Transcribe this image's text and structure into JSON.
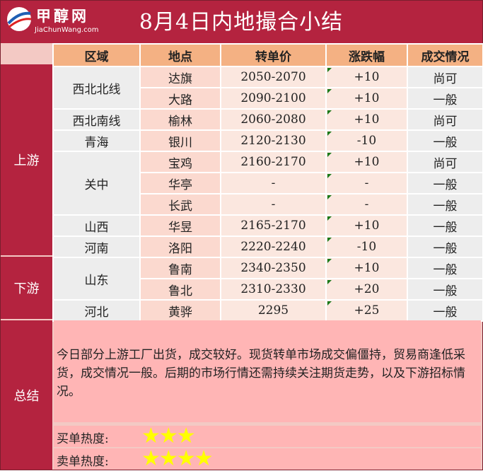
{
  "logo": {
    "cn": "甲醇网",
    "en": "JiaChunWang.com"
  },
  "title": "8月4日内地撮合小结",
  "columns": [
    "区域",
    "地点",
    "转单价",
    "涨跌幅",
    "成交情况"
  ],
  "sections": {
    "upstream": "上游",
    "downstream": "下游",
    "summary": "总结"
  },
  "rows": [
    {
      "region": "西北北线",
      "rowspan": 2,
      "location": "达旗",
      "price": "2050-2070",
      "change": "+10",
      "deal": "尚可"
    },
    {
      "location": "大路",
      "price": "2090-2100",
      "change": "+10",
      "deal": "一般"
    },
    {
      "region": "西北南线",
      "rowspan": 1,
      "location": "榆林",
      "price": "2060-2080",
      "change": "+10",
      "deal": "尚可"
    },
    {
      "region": "青海",
      "rowspan": 1,
      "location": "银川",
      "price": "2120-2130",
      "change": "-10",
      "deal": "一般"
    },
    {
      "region": "关中",
      "rowspan": 3,
      "location": "宝鸡",
      "price": "2160-2170",
      "change": "+10",
      "deal": "尚可"
    },
    {
      "location": "华亭",
      "price": "-",
      "change": "-",
      "deal": "一般"
    },
    {
      "location": "长武",
      "price": "-",
      "change": "-",
      "deal": "一般"
    },
    {
      "region": "山西",
      "rowspan": 1,
      "location": "华昱",
      "price": "2165-2170",
      "change": "+10",
      "deal": "一般"
    },
    {
      "region": "河南",
      "rowspan": 1,
      "location": "洛阳",
      "price": "2220-2240",
      "change": "-10",
      "deal": "一般"
    },
    {
      "region": "山东",
      "rowspan": 2,
      "location": "鲁南",
      "price": "2340-2350",
      "change": "+10",
      "deal": "一般"
    },
    {
      "location": "鲁北",
      "price": "2310-2330",
      "change": "+20",
      "deal": "一般"
    },
    {
      "region": "河北",
      "rowspan": 1,
      "location": "黄骅",
      "price": "2295",
      "change": "+25",
      "deal": "一般"
    }
  ],
  "summary_text": "今日部分上游工厂出货，成交较好。现货转单市场成交偏僵持，贸易商逢低采货，成交情况一般。后期的市场行情还需持续关注期货走势，以及下游招标情况。",
  "buy_heat": {
    "label": "买单热度:",
    "stars": 3
  },
  "sell_heat": {
    "label": "卖单热度:",
    "stars": 4
  },
  "colors": {
    "header": "#b4233f",
    "column_header": "#f4b183",
    "summary_bg": "#ffb5b5",
    "star": "#ffff00"
  }
}
